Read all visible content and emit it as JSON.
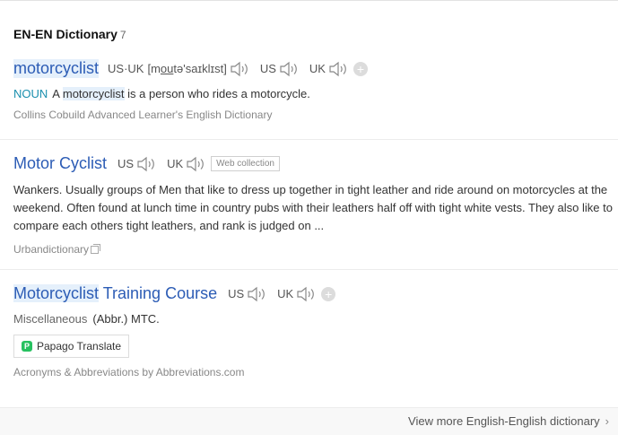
{
  "section": {
    "title": "EN-EN Dictionary",
    "count": "7"
  },
  "entries": [
    {
      "headword": "motorcyclist",
      "us_uk_label": "US·UK",
      "phonetic_pre": "[m",
      "phonetic_underlined": "ou",
      "phonetic_post": "tə'saɪklɪst]",
      "us_label": "US",
      "uk_label": "UK",
      "add": "+",
      "pos": "NOUN",
      "def_a": "A",
      "def_hl": "motorcyclist",
      "def_rest": "is a person who rides a motorcycle.",
      "source": "Collins Cobuild Advanced Learner's English Dictionary"
    },
    {
      "headword": "Motor Cyclist",
      "us_label": "US",
      "uk_label": "UK",
      "tag": "Web collection",
      "definition": "Wankers. Usually groups of Men that like to dress up together in tight leather and ride around on motorcycles at the weekend. Often found at lunch time in country pubs with their leathers half off with tight white vests. They also like to compare each others tight leathers, and rank is judged on ...",
      "source": "Urbandictionary"
    },
    {
      "headword_hl": "Motorcyclist",
      "headword_rest": "Training Course",
      "us_label": "US",
      "uk_label": "UK",
      "add": "+",
      "misc": "Miscellaneous",
      "definition": "(Abbr.) MTC.",
      "translate": "Papago Translate",
      "source": "Acronyms & Abbreviations by Abbreviations.com"
    }
  ],
  "footer": {
    "link": "View more English-English dictionary",
    "chevron": "›"
  },
  "icons": {
    "speaker": "speaker-icon",
    "add": "plus-icon",
    "papago": "papago-logo-icon",
    "external": "external-link-icon"
  },
  "colors": {
    "link": "#2c5cb5",
    "highlight": "#e5f0fb",
    "pos": "#1a8fae",
    "source": "#888888"
  }
}
